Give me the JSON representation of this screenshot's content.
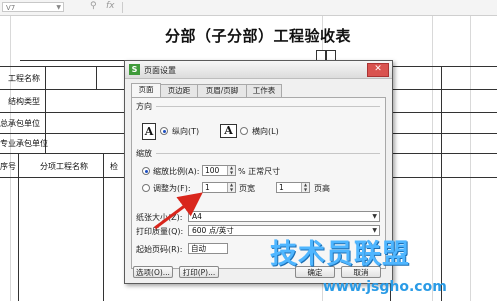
{
  "formula_bar": {
    "cell_ref": "V7",
    "zoom_icon": "zoom-icon",
    "fx_label": "fx"
  },
  "sheet": {
    "title": "分部（子分部）工程验收表",
    "rows": [
      {
        "label": "工程名称"
      },
      {
        "label": "结构类型"
      },
      {
        "label": "总承包单位"
      },
      {
        "label": "专业承包单位"
      }
    ],
    "header_row": {
      "col1": "序号",
      "col2": "分项工程名称",
      "col3": "检"
    }
  },
  "dialog": {
    "title": "页面设置",
    "app_icon_letter": "S",
    "close_label": "✕",
    "tabs": [
      {
        "label": "页面",
        "active": true
      },
      {
        "label": "页边距",
        "active": false
      },
      {
        "label": "页眉/页脚",
        "active": false
      },
      {
        "label": "工作表",
        "active": false
      }
    ],
    "orientation": {
      "group_label": "方向",
      "portrait_label": "纵向(T)",
      "landscape_label": "横向(L)",
      "selected": "portrait"
    },
    "scaling": {
      "group_label": "缩放",
      "adjust_label": "缩放比例(A):",
      "adjust_value": "100",
      "adjust_suffix": "% 正常尺寸",
      "fit_label": "调整为(F):",
      "fit_wide_value": "1",
      "fit_wide_suffix": "页宽",
      "fit_tall_value": "1",
      "fit_tall_suffix": "页高",
      "selected": "adjust"
    },
    "paper_size": {
      "label": "纸张大小(Z):",
      "value": "A4"
    },
    "print_quality": {
      "label": "打印质量(Q):",
      "value": "600 点/英寸"
    },
    "first_page": {
      "label": "起始页码(R):",
      "value": "自动"
    },
    "buttons": {
      "options": "选项(O)...",
      "print": "打印(P)...",
      "ok": "确定",
      "cancel": "取消"
    }
  },
  "watermark": {
    "text": "技术员联盟",
    "url": "www.jsgho.com"
  },
  "colors": {
    "watermark": "#4fb6ff",
    "arrow": "#d9261c",
    "radio_selected": "#1f4fbf",
    "dialog_bg": "#f0f0f0"
  }
}
